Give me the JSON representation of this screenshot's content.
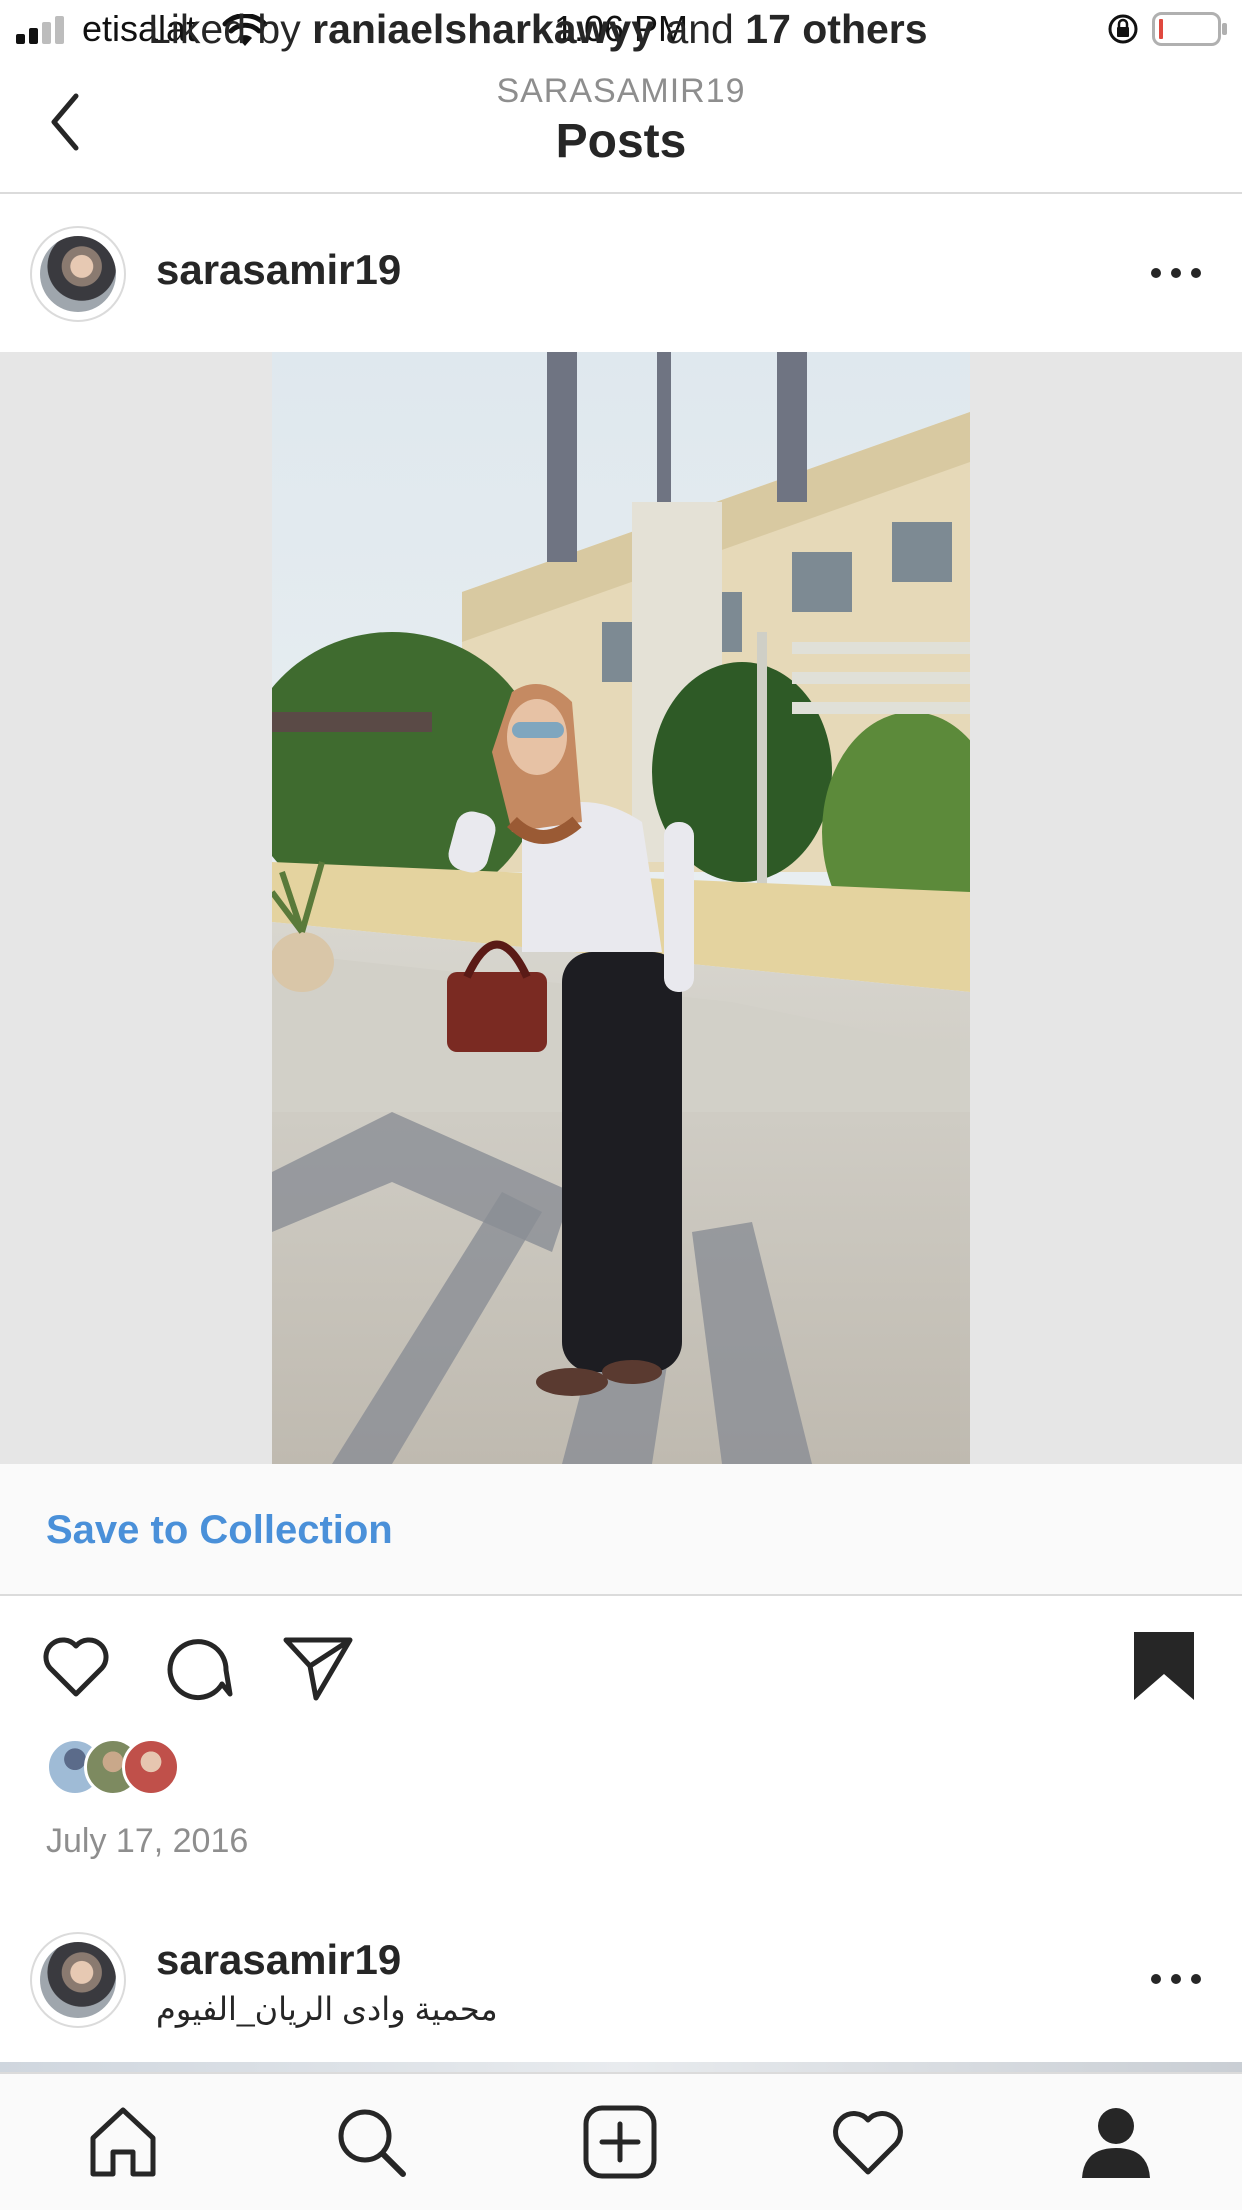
{
  "status_bar": {
    "carrier": "etisalat",
    "time": "1:06 PM"
  },
  "nav": {
    "subtitle": "SARASAMIR19",
    "title": "Posts"
  },
  "post": {
    "username": "sarasamir19",
    "save_to_collection": "Save to Collection",
    "liked_by_prefix": "Liked by",
    "liked_by_user": "raniaelsharkawyy",
    "liked_by_and": "and",
    "liked_by_others": "17 others",
    "date": "July 17, 2016",
    "bookmarked": true
  },
  "next_post": {
    "username": "sarasamir19",
    "location": "محمية وادى الريان_الفيوم"
  },
  "tab_bar": {
    "items": [
      "home",
      "search",
      "create",
      "activity",
      "profile"
    ],
    "active": "profile"
  },
  "colors": {
    "link_blue": "#4a90d9",
    "text_primary": "#262626",
    "text_secondary": "#8e8e8e",
    "divider": "#dbdbdb"
  }
}
